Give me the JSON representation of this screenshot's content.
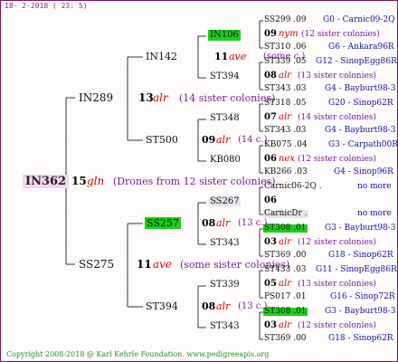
{
  "header": {
    "stamp": "18- 2-2018 ( 23: 5)"
  },
  "footer": {
    "copyright": "Copyright 2008-2018 @ Karl Kehrle Foundation.   www.pedigreeapis.org"
  },
  "colors": {
    "frame": "#7a1a5a",
    "breeder_code": "#d10000",
    "note": "#7a1a9a",
    "right_column": "#1010a0",
    "highlight": "#1ccf1c"
  },
  "root": {
    "name": "IN362",
    "year": "15",
    "code": "gln",
    "note": "(Drones from 12 sister colonies)"
  },
  "gen1": {
    "upper": {
      "name": "IN289",
      "year": "13",
      "code": "alr",
      "note": "(14 sister colonies)"
    },
    "lower": {
      "name": "SS275",
      "year": "11",
      "code": "ave",
      "note": "(some sister colonies)"
    }
  },
  "gen2": {
    "a": {
      "name": "IN142",
      "year": "11",
      "code": "ave",
      "note": "(some c.)"
    },
    "b": {
      "name": "ST500",
      "year": "09",
      "code": "alr",
      "note": "(14 c.)"
    },
    "c": {
      "name": "SS257",
      "year": "08",
      "code": "alr",
      "note": "(13 c.)"
    },
    "d": {
      "name": "ST394",
      "year": "08",
      "code": "alr",
      "note": "(13 c.)"
    }
  },
  "gen3": [
    "IN106",
    "ST394",
    "ST348",
    "KB080",
    "SS267",
    "ST343",
    "ST339",
    "ST343"
  ],
  "gen4": [
    {
      "top": "SS299 .09",
      "top_r": "G0 - Carnic09-2Q",
      "year": "09",
      "code": "nym",
      "note": "(12 sister colonies)",
      "bottom": "ST310 .06",
      "bottom_r": "G6 - Ankara96R"
    },
    {
      "top": "ST339 .05",
      "top_r": "G12 - SinopEgg86R",
      "year": "08",
      "code": "alr",
      "note": "(13 sister colonies)",
      "bottom": "ST343 .03",
      "bottom_r": "G4 - Bayburt98-3"
    },
    {
      "top": "ST318 .05",
      "top_r": "G20 - Sinop62R",
      "year": "07",
      "code": "alr",
      "note": "(14 sister colonies)",
      "bottom": "ST343 .03",
      "bottom_r": "G4 - Bayburt98-3"
    },
    {
      "top": "KB075 .04",
      "top_r": "G3 - Carpath00R",
      "year": "06",
      "code": "nex",
      "note": "(12 sister colonies)",
      "bottom": "KB266 .03",
      "bottom_r": "G4 - Sinop96R"
    },
    {
      "top": "Carnic06-2Q .",
      "top_r": "no more",
      "year": "06",
      "code": "",
      "note": "",
      "bottom": "CarnicDr .",
      "bottom_r": "no more"
    },
    {
      "top": "ST308 .01",
      "top_r": "G3 - Bayburt98-3",
      "year": "03",
      "code": "alr",
      "note": "(12 sister colonies)",
      "bottom": "ST369 .00",
      "bottom_r": "G18 - Sinop62R"
    },
    {
      "top": "ST433 .03",
      "top_r": "G11 - SinopEgg86R",
      "year": "05",
      "code": "alr",
      "note": "(13 sister colonies)",
      "bottom": "PS017 .01",
      "bottom_r": "G16 - Sinop72R"
    },
    {
      "top": "ST308 .01",
      "top_r": "G3 - Bayburt98-3",
      "year": "03",
      "code": "alr",
      "note": "(12 sister colonies)",
      "bottom": "ST369 .00",
      "bottom_r": "G18 - Sinop62R"
    }
  ]
}
